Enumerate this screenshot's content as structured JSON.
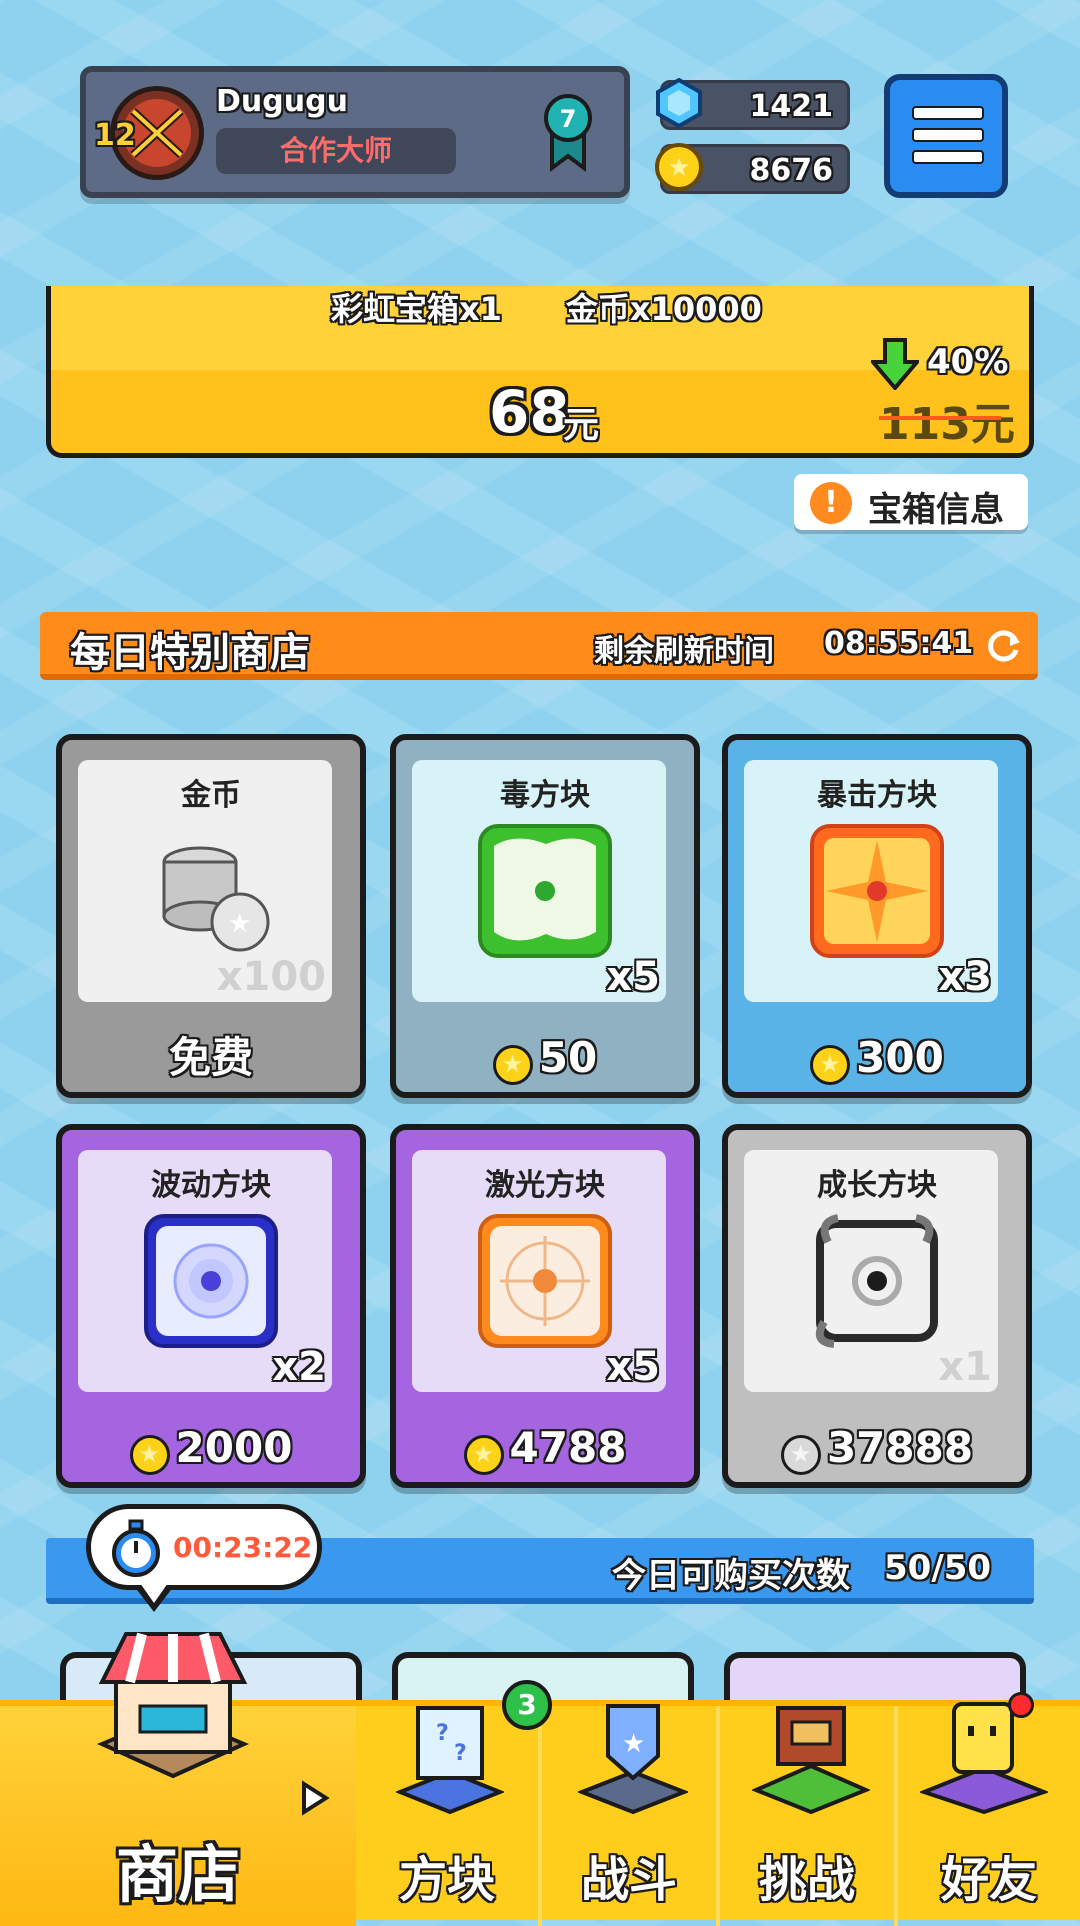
{
  "profile": {
    "username": "Dugugu",
    "level": "12",
    "title": "合作大师",
    "rank": "7"
  },
  "currency": {
    "gems": "1421",
    "coins": "8676"
  },
  "promo": {
    "items": "彩虹宝箱x1　　金币x10000",
    "price": "68",
    "price_unit": "元",
    "discount": "40%",
    "original_price": "113元"
  },
  "info_button": {
    "label": "宝箱信息",
    "icon": "!"
  },
  "daily_shop": {
    "title": "每日特别商店",
    "refresh_label": "剩余刷新时间",
    "timer": "08:55:41"
  },
  "cards": [
    {
      "name": "金币",
      "qty": "x100",
      "price": "免费",
      "currency": "none",
      "bg": "#f0f0f0",
      "footer": "#9a9a9a"
    },
    {
      "name": "毒方块",
      "qty": "x5",
      "price": "50",
      "currency": "coin",
      "bg": "#d8f3f8",
      "footer": "#8fb1c2"
    },
    {
      "name": "暴击方块",
      "qty": "x3",
      "price": "300",
      "currency": "coin",
      "bg": "#d8f3f8",
      "footer": "#59b3e6"
    },
    {
      "name": "波动方块",
      "qty": "x2",
      "price": "2000",
      "currency": "coin",
      "bg": "#e6dcf8",
      "footer": "#a564e0"
    },
    {
      "name": "激光方块",
      "qty": "x5",
      "price": "4788",
      "currency": "coin",
      "bg": "#e6dcf8",
      "footer": "#a564e0"
    },
    {
      "name": "成长方块",
      "qty": "x1",
      "price": "37888",
      "currency": "coin-grey",
      "bg": "#f0f0f0",
      "footer": "#bfbfbf"
    }
  ],
  "purchase": {
    "label": "今日可购买次数",
    "count": "50/50",
    "timer": "00:23:22"
  },
  "nav": {
    "items": [
      {
        "label": "商店",
        "icon": "shop-icon"
      },
      {
        "label": "方块",
        "icon": "dice-icon",
        "badge": "3"
      },
      {
        "label": "战斗",
        "icon": "battle-icon"
      },
      {
        "label": "挑战",
        "icon": "challenge-icon"
      },
      {
        "label": "好友",
        "icon": "friends-icon"
      }
    ]
  }
}
